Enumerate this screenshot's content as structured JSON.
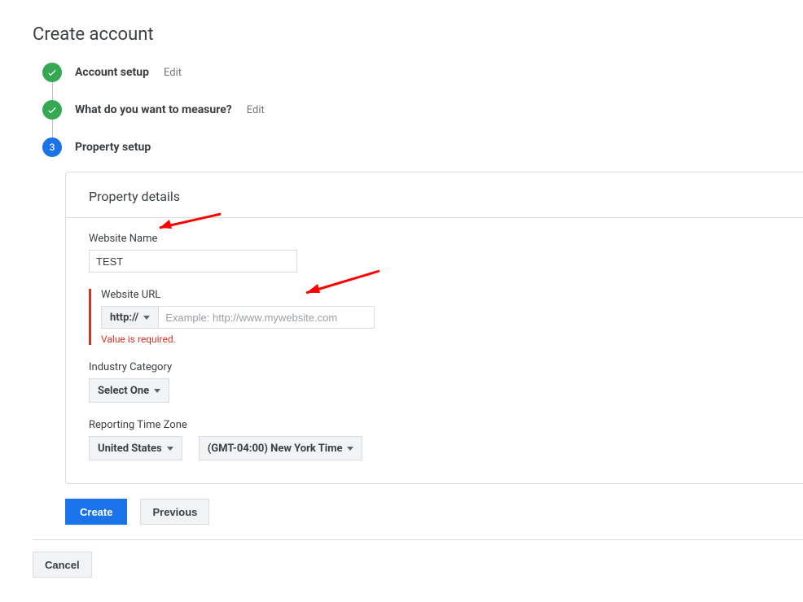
{
  "page_title": "Create account",
  "stepper": {
    "step1": {
      "title": "Account setup",
      "edit": "Edit"
    },
    "step2": {
      "title": "What do you want to measure?",
      "edit": "Edit"
    },
    "step3": {
      "number": "3",
      "title": "Property setup"
    }
  },
  "panel": {
    "header": "Property details",
    "website_name": {
      "label": "Website Name",
      "value": "TEST"
    },
    "website_url": {
      "label": "Website URL",
      "protocol": "http://",
      "placeholder": "Example: http://www.mywebsite.com",
      "value": "",
      "error": "Value is required."
    },
    "industry": {
      "label": "Industry Category",
      "selected": "Select One"
    },
    "timezone": {
      "label": "Reporting Time Zone",
      "country": "United States",
      "zone": "(GMT-04:00) New York Time"
    }
  },
  "buttons": {
    "create": "Create",
    "previous": "Previous",
    "cancel": "Cancel"
  },
  "colors": {
    "primary": "#1a73e8",
    "success": "#34a853",
    "error": "#d93025"
  }
}
